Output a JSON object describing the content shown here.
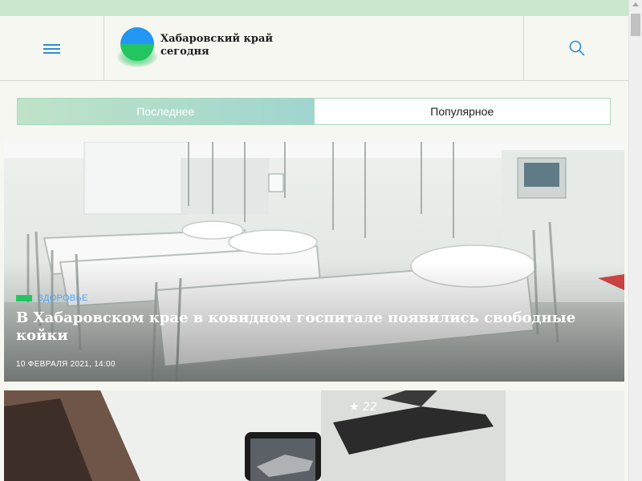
{
  "site": {
    "logo_line1": "Хабаровский край",
    "logo_line2": "сегодня",
    "brand_colors": {
      "blue": "#2196f3",
      "green": "#22c55e",
      "link": "#2a8fd0"
    }
  },
  "header": {
    "menu_icon": "hamburger-icon",
    "search_icon": "search-icon"
  },
  "tabs": [
    {
      "label": "Последнее",
      "active": true
    },
    {
      "label": "Популярное",
      "active": false
    }
  ],
  "articles": [
    {
      "category": "Здоровье",
      "title": "В Хабаровском крае в ковидном госпитале появились свободные койки",
      "date": "10 февраля 2021, 14:00",
      "image": "hospital-ward-photo"
    },
    {
      "image": "phone-photo-airplane"
    }
  ]
}
